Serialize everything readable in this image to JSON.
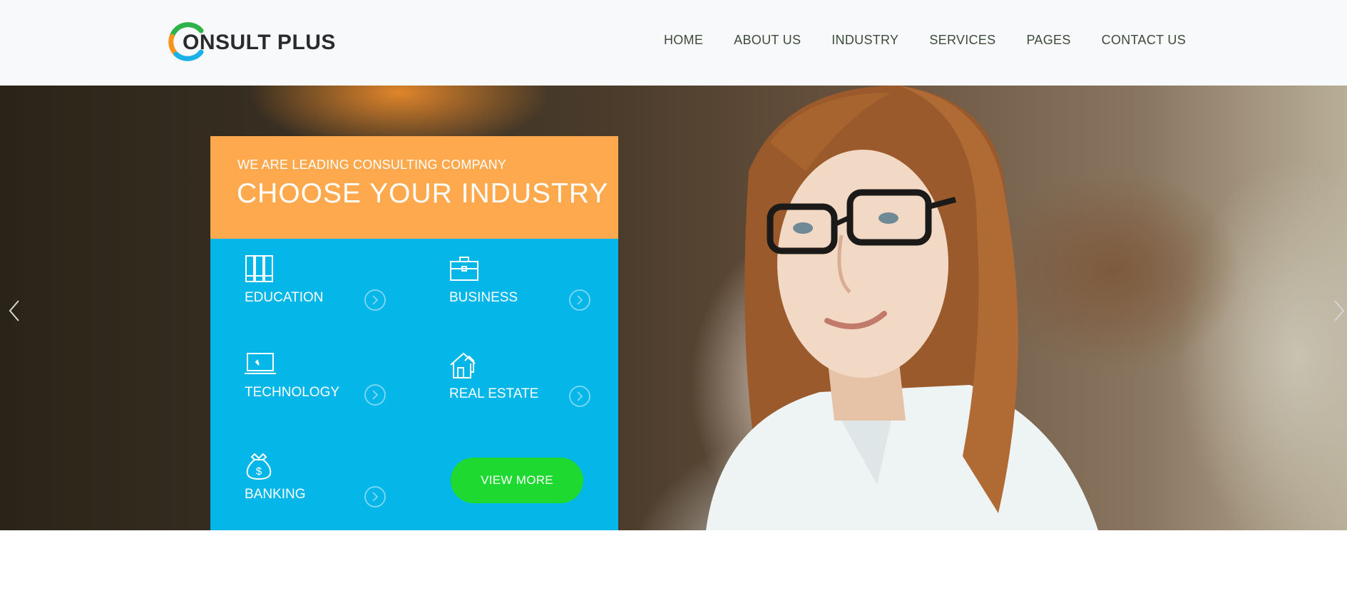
{
  "brand": {
    "logo_text": "ONSULT PLUS",
    "logo_letter": "C"
  },
  "nav": {
    "items": [
      "HOME",
      "ABOUT US",
      "INDUSTRY",
      "SERVICES",
      "PAGES",
      "CONTACT US"
    ]
  },
  "hero": {
    "prev_icon": "chevron-left-icon",
    "next_icon": "chevron-right-icon"
  },
  "panel": {
    "subtitle": "WE ARE LEADING CONSULTING COMPANY",
    "title": "CHOOSE YOUR INDUSTRY",
    "industries": [
      {
        "label": "EDUCATION",
        "icon": "books-icon"
      },
      {
        "label": "BUSINESS",
        "icon": "briefcase-icon"
      },
      {
        "label": "TECHNOLOGY",
        "icon": "laptop-icon"
      },
      {
        "label": "REAL ESTATE",
        "icon": "house-icon"
      },
      {
        "label": "BANKING",
        "icon": "money-bag-icon"
      }
    ],
    "view_more": "VIEW MORE"
  },
  "colors": {
    "header_bg": "#f7f9fa",
    "panel_orange": "#ffa94e",
    "panel_blue": "#05b6e8",
    "button_green": "#1ed930",
    "logo_green": "#2db34a",
    "logo_orange": "#f7941d",
    "logo_blue": "#1ab0e8"
  }
}
